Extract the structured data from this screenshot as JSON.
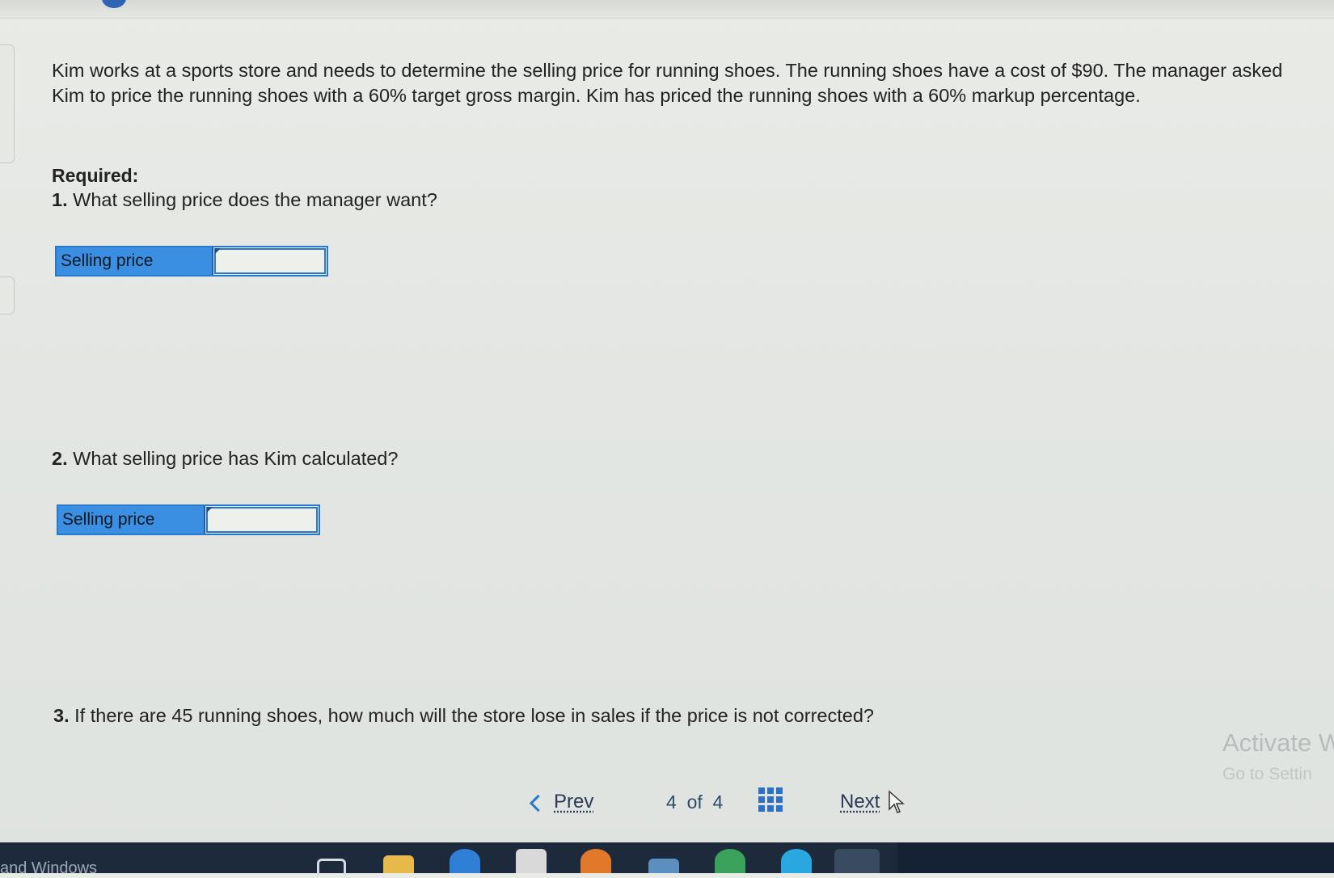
{
  "problem": {
    "text": "Kim works at a sports store and needs to determine the selling price for running shoes. The running shoes have a cost of $90. The manager asked Kim to price the running shoes with a 60% target gross margin. Kim has priced the running shoes with a 60% markup percentage.",
    "required_label": "Required:"
  },
  "questions": [
    {
      "number": "1.",
      "text": "What selling price does the manager want?",
      "answer_label": "Selling price",
      "answer_value": ""
    },
    {
      "number": "2.",
      "text": "What selling price has Kim calculated?",
      "answer_label": "Selling price",
      "answer_value": ""
    },
    {
      "number": "3.",
      "text": "If there are 45 running shoes, how much will the store lose in sales if the price is not corrected?"
    }
  ],
  "navigation": {
    "prev_label": "Prev",
    "current_page": "4",
    "of_label": "of",
    "total_pages": "4",
    "next_label": "Next"
  },
  "watermark": {
    "line1": "Activate W",
    "line2": "Go to Settin"
  },
  "taskbar": {
    "left_text": "and Windows",
    "icons": [
      "task-view-icon",
      "file-explorer-icon",
      "edge-icon",
      "store-icon",
      "firefox-icon",
      "calculator-icon",
      "chrome-icon",
      "skype-icon",
      "chrome-app-icon"
    ]
  },
  "colors": {
    "accent": "#2a78c8",
    "label_bg": "#3b8fe3",
    "taskbar": "#1c2a3c"
  }
}
